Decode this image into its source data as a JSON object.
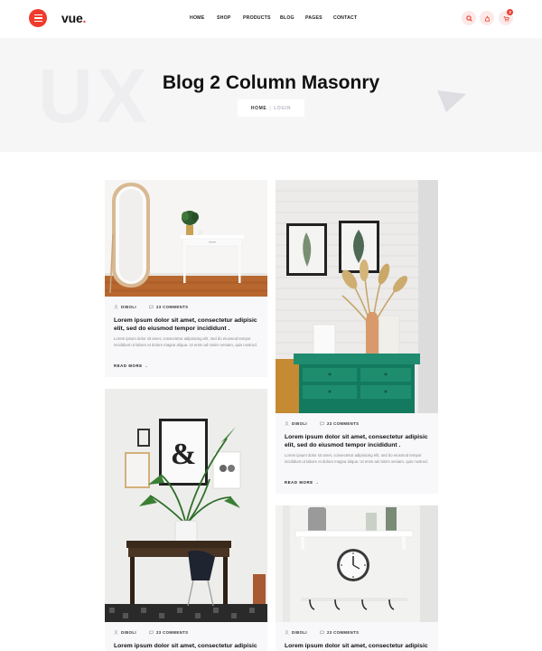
{
  "header": {
    "logo_text": "vue",
    "logo_dot": ".",
    "nav": [
      "HOME",
      "SHOP",
      "PRODUCTS",
      "BLOG",
      "PAGES",
      "CONTACT"
    ],
    "cart_count": "3"
  },
  "hero": {
    "bg_text": "UX",
    "title": "Blog 2 Column Masonry",
    "breadcrumb_home": "HOME",
    "breadcrumb_sep": "|",
    "breadcrumb_current": "LOGIN"
  },
  "posts": [
    {
      "author": "DIBOLI",
      "comments": "23 COMMENTS",
      "title": "Lorem ipsum dolor sit amet, consectetur adipisic elit, sed do eiusmod tempor incididunt .",
      "excerpt": "Lorem ipsum dolor sit amet, consectetur adipisicing elit, sed do eiusmod tempor incididunt ut labore et dolore magna aliqua. Ut enim ad minim veniam, quis nostrud.",
      "read_more": "READ MORE"
    },
    {
      "author": "DIBOLI",
      "comments": "23 COMMENTS",
      "title": "Lorem ipsum dolor sit amet, consectetur adipisic elit, sed do eiusmod tempor incididunt .",
      "excerpt": "Lorem ipsum dolor sit amet, consectetur adipisicing elit, sed do eiusmod tempor incididunt ut labore et dolore magna aliqua. Ut enim ad minim veniam, quis nostrud.",
      "read_more": "READ MORE"
    },
    {
      "author": "DIBOLI",
      "comments": "23 COMMENTS",
      "title": "Lorem ipsum dolor sit amet, consectetur adipisic"
    },
    {
      "author": "DIBOLI",
      "comments": "23 COMMENTS",
      "title": "Lorem ipsum dolor sit amet, consectetur adipisic"
    }
  ],
  "colors": {
    "accent": "#ef3b2d",
    "hero_bg": "#f6f6f7",
    "card_bg": "#f8f8fb"
  },
  "icons": {
    "menu": "hamburger-icon",
    "search": "search-icon",
    "user": "user-icon",
    "cart": "cart-icon",
    "author": "user-icon",
    "comments": "comment-icon",
    "read_more": "arrow-right-icon"
  }
}
